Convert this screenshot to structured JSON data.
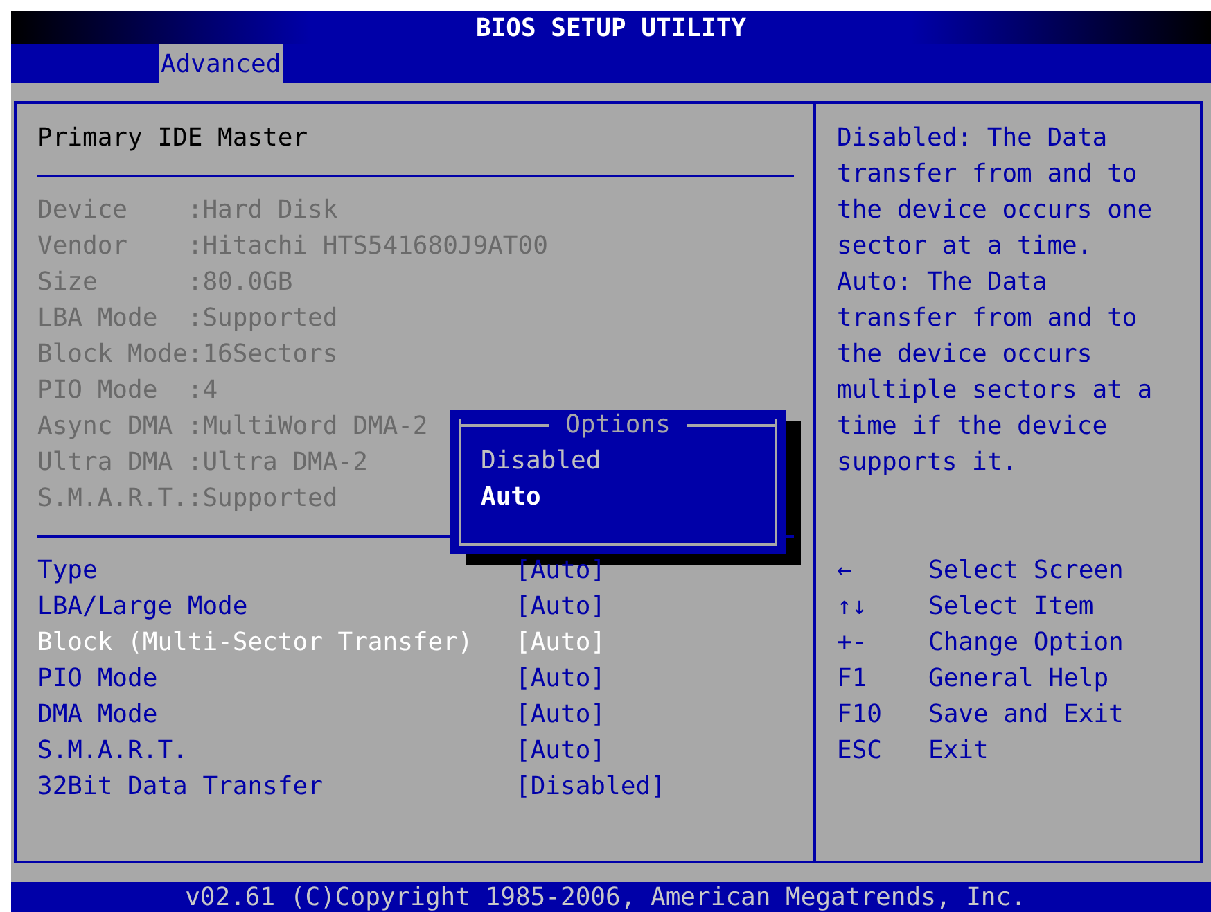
{
  "title": "BIOS SETUP UTILITY",
  "tabs": [
    {
      "label": "Advanced",
      "selected": true
    }
  ],
  "section_title": "Primary IDE Master",
  "info": [
    {
      "label": "Device",
      "value": ":Hard Disk"
    },
    {
      "label": "Vendor",
      "value": ":Hitachi HTS541680J9AT00"
    },
    {
      "label": "Size",
      "value": ":80.0GB"
    },
    {
      "label": "LBA Mode",
      "value": ":Supported"
    },
    {
      "label": "Block Mode",
      "value": ":16Sectors"
    },
    {
      "label": "PIO Mode",
      "value": ":4"
    },
    {
      "label": "Async DMA",
      "value": ":MultiWord DMA-2"
    },
    {
      "label": "Ultra DMA",
      "value": ":Ultra DMA-2"
    },
    {
      "label": "S.M.A.R.T.",
      "value": ":Supported"
    }
  ],
  "settings": [
    {
      "label": "Type",
      "value": "[Auto]",
      "selected": false
    },
    {
      "label": "LBA/Large Mode",
      "value": "[Auto]",
      "selected": false
    },
    {
      "label": "Block (Multi-Sector Transfer)",
      "value": "[Auto]",
      "selected": true
    },
    {
      "label": "PIO Mode",
      "value": "[Auto]",
      "selected": false
    },
    {
      "label": "DMA Mode",
      "value": "[Auto]",
      "selected": false
    },
    {
      "label": "S.M.A.R.T.",
      "value": "[Auto]",
      "selected": false
    },
    {
      "label": "32Bit Data Transfer",
      "value": "[Disabled]",
      "selected": false
    }
  ],
  "popup": {
    "title": "Options",
    "options": [
      {
        "label": "Disabled",
        "selected": false
      },
      {
        "label": "Auto",
        "selected": true
      }
    ]
  },
  "help": [
    "Disabled: The Data transfer from and to the device occurs one sector at a time.",
    "Auto: The Data transfer from and to the device occurs multiple sectors at a time if the device supports it."
  ],
  "keys": [
    {
      "key": "←",
      "action": "Select Screen"
    },
    {
      "key": "↑↓",
      "action": "Select Item"
    },
    {
      "key": "+-",
      "action": "Change Option"
    },
    {
      "key": "F1",
      "action": "General Help"
    },
    {
      "key": "F10",
      "action": "Save and Exit"
    },
    {
      "key": "ESC",
      "action": "Exit"
    }
  ],
  "footer": "v02.61 (C)Copyright 1985-2006, American Megatrends, Inc."
}
